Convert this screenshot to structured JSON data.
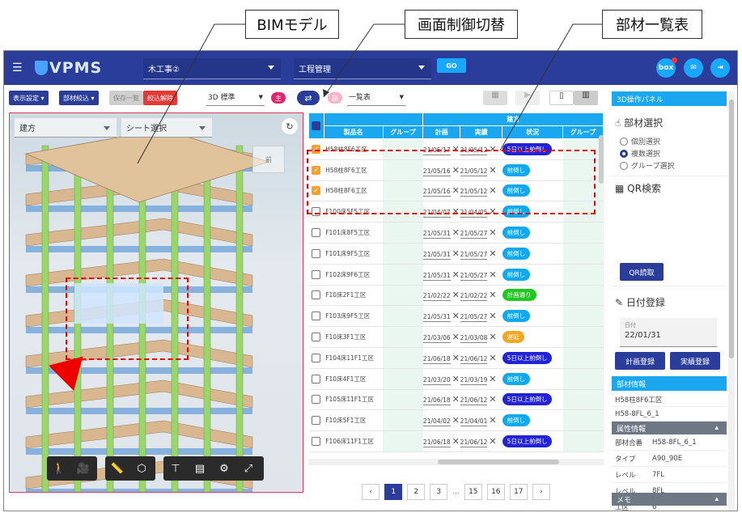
{
  "callouts": {
    "bim": "BIMモデル",
    "switch": "画面制御切替",
    "list": "部材一覧表"
  },
  "header": {
    "logo": "VPMS",
    "project": "木工事②",
    "mode": "工程管理",
    "go": "GO",
    "box": "box"
  },
  "toolbar": {
    "display_settings": "表示設定",
    "filter": "部材絞込",
    "saved_list": "保存一覧",
    "clear_filter": "絞込解除",
    "view_mode": "3D 標準",
    "badge_main": "主",
    "badge_sub": "副",
    "list_mode": "一覧表"
  },
  "viewport": {
    "area_select": "建方",
    "sheet_select": "シート選択",
    "cube_label": "前",
    "tools": [
      "person-icon",
      "camera-icon",
      "ruler-icon",
      "box-icon",
      "tree-icon",
      "building-icon",
      "gear-icon",
      "fullscreen-icon"
    ]
  },
  "table": {
    "group_header": "建方",
    "columns": [
      "製品名",
      "グループ",
      "計画",
      "実績",
      "状況",
      "グループ"
    ],
    "rows": [
      {
        "checked": true,
        "name": "H58柱8F6工区",
        "plan": "21/05/17",
        "actual": "21/05/12",
        "status": "5日以上前倒し",
        "color": "#2222d6"
      },
      {
        "checked": true,
        "name": "H58柱8F6工区",
        "plan": "21/05/16",
        "actual": "21/05/12",
        "status": "前倒し",
        "color": "#12a8f0"
      },
      {
        "checked": true,
        "name": "H58柱8F6工区",
        "plan": "21/05/16",
        "actual": "21/05/12",
        "status": "前倒し",
        "color": "#12a8f0"
      },
      {
        "checked": false,
        "name": "F100床5F5工区",
        "plan": "21/04/07",
        "actual": "21/04/05",
        "status": "前倒し",
        "color": "#12a8f0"
      },
      {
        "checked": false,
        "name": "F101床8F5工区",
        "plan": "21/05/31",
        "actual": "21/05/27",
        "status": "前倒し",
        "color": "#12a8f0"
      },
      {
        "checked": false,
        "name": "F101床9F5工区",
        "plan": "21/05/31",
        "actual": "21/05/27",
        "status": "前倒し",
        "color": "#12a8f0"
      },
      {
        "checked": false,
        "name": "F102床9F6工区",
        "plan": "21/05/31",
        "actual": "21/05/27",
        "status": "前倒し",
        "color": "#12a8f0"
      },
      {
        "checked": false,
        "name": "F10床2F1工区",
        "plan": "21/02/22",
        "actual": "21/02/22",
        "status": "計画通り",
        "color": "#22c822"
      },
      {
        "checked": false,
        "name": "F103床9F5工区",
        "plan": "21/05/31",
        "actual": "21/05/27",
        "status": "前倒し",
        "color": "#12a8f0"
      },
      {
        "checked": false,
        "name": "F10床3F1工区",
        "plan": "21/03/06",
        "actual": "21/03/08",
        "status": "遅延",
        "color": "#f5a623"
      },
      {
        "checked": false,
        "name": "F104床11F1工区",
        "plan": "21/06/18",
        "actual": "21/06/12",
        "status": "5日以上前倒し",
        "color": "#2222d6"
      },
      {
        "checked": false,
        "name": "F10床4F1工区",
        "plan": "21/03/20",
        "actual": "21/03/19",
        "status": "前倒し",
        "color": "#12a8f0"
      },
      {
        "checked": false,
        "name": "F105床11F1工区",
        "plan": "21/06/18",
        "actual": "21/06/12",
        "status": "5日以上前倒し",
        "color": "#2222d6"
      },
      {
        "checked": false,
        "name": "F10床5F1工区",
        "plan": "21/04/02",
        "actual": "21/04/01",
        "status": "前倒し",
        "color": "#12a8f0"
      },
      {
        "checked": false,
        "name": "F106床11F1工区",
        "plan": "21/06/18",
        "actual": "21/06/12",
        "status": "5日以上前倒し",
        "color": "#2222d6"
      }
    ]
  },
  "pager": {
    "pages": [
      "1",
      "2",
      "3",
      "...",
      "15",
      "16",
      "17"
    ],
    "current": "1"
  },
  "panel": {
    "title": "3D操作パネル",
    "select_title": "部材選択",
    "radios": [
      {
        "label": "個別選択",
        "on": false
      },
      {
        "label": "複数選択",
        "on": true
      },
      {
        "label": "グループ選択",
        "on": false
      }
    ],
    "qr_title": "QR検索",
    "qr_button": "QR読取",
    "date_title": "日付登録",
    "date_label": "日付",
    "date_value": "22/01/31",
    "plan_btn": "計画登録",
    "actual_btn": "実績登録",
    "info_title": "部材情報",
    "info_lines": [
      "H58柱8F6工区",
      "H58-8FL_6_1"
    ],
    "attr_title": "属性情報",
    "attrs": [
      {
        "k": "部材合番",
        "v": "H58-8FL_6_1"
      },
      {
        "k": "タイプ",
        "v": "A90_90E"
      },
      {
        "k": "レベル",
        "v": "7FL"
      },
      {
        "k": "レベル",
        "v": "8FL"
      },
      {
        "k": "工区",
        "v": "6"
      }
    ],
    "memo_title": "メモ"
  }
}
